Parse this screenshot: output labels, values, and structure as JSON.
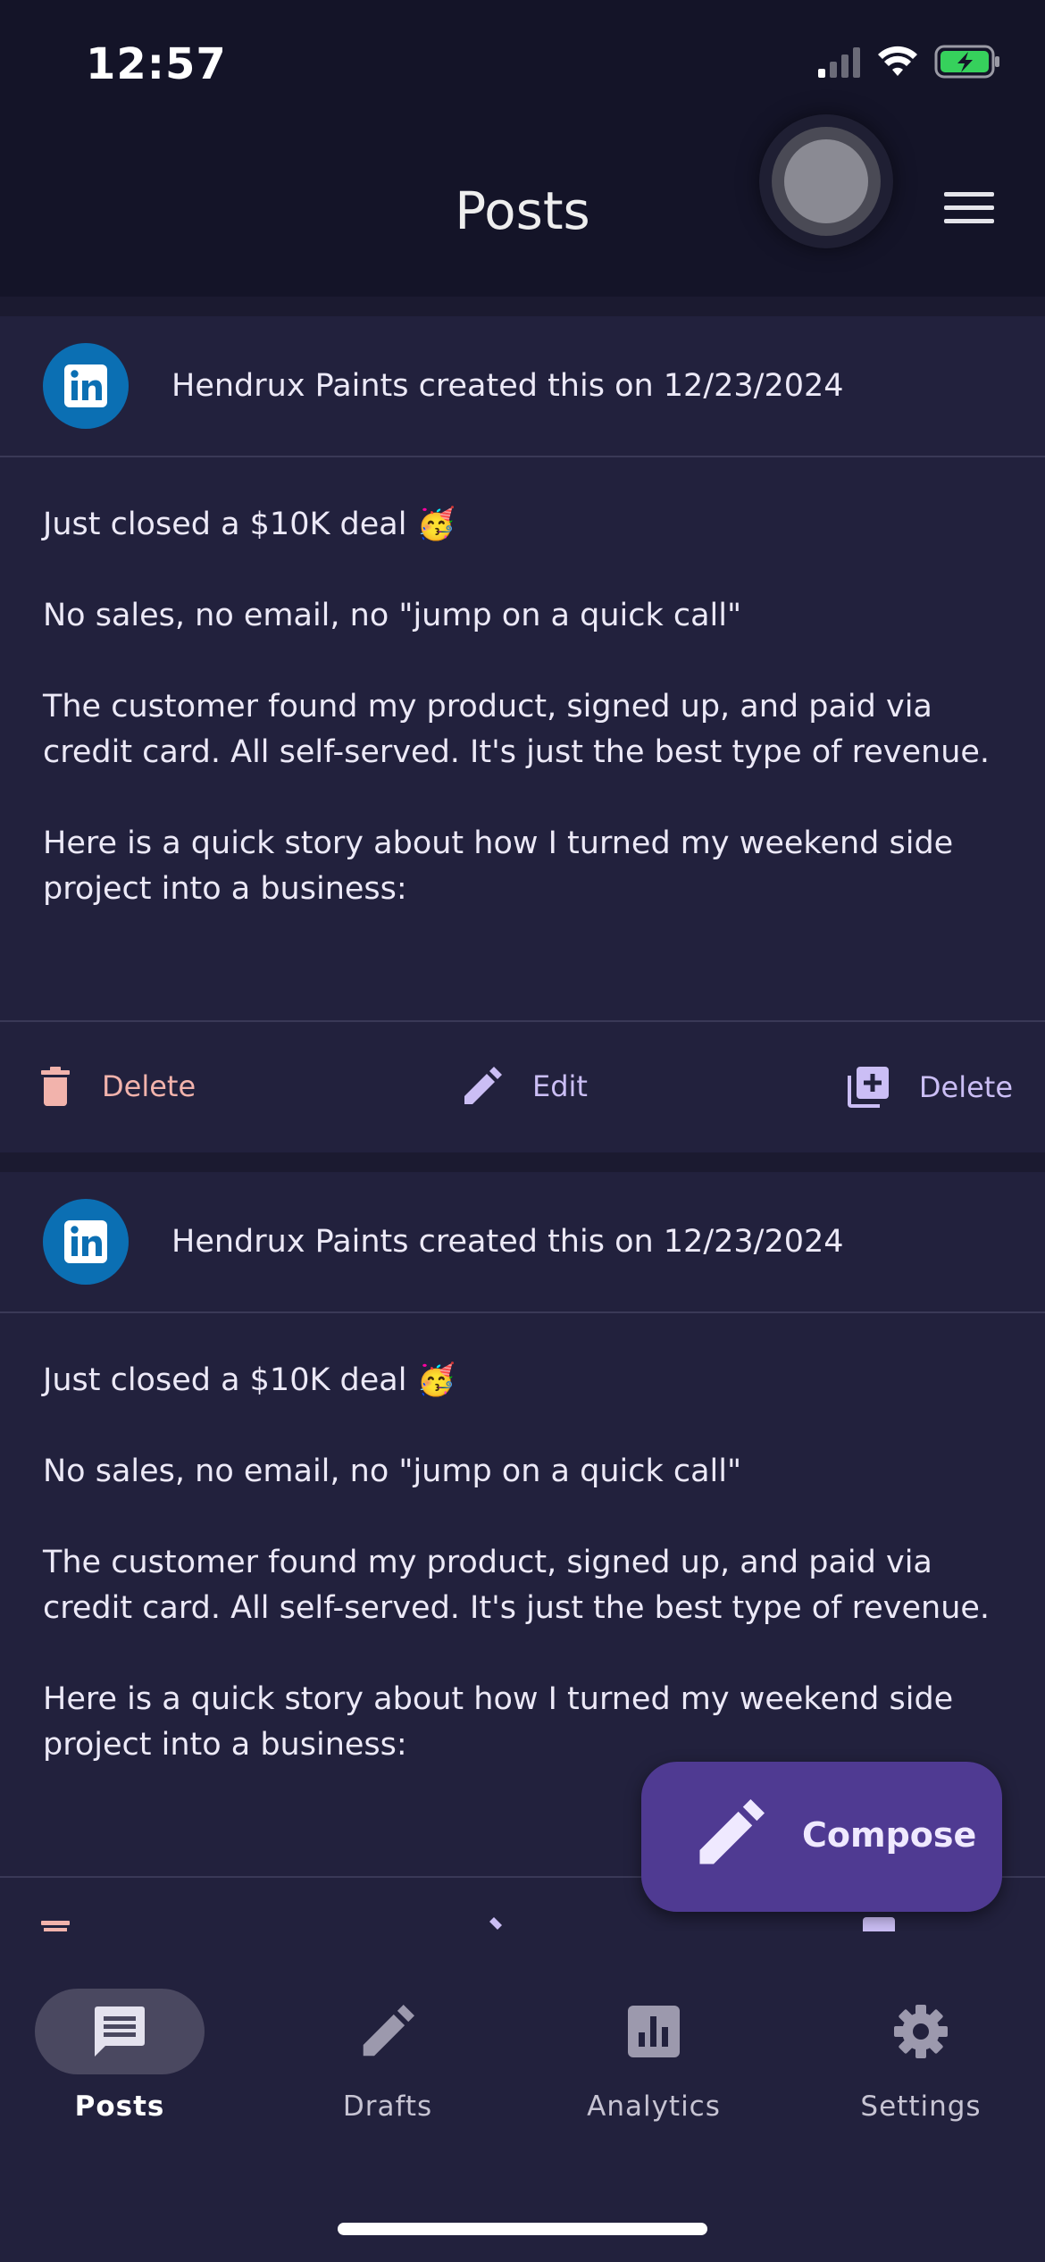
{
  "status_bar": {
    "time": "12:57",
    "icons": [
      "cellular-signal-icon",
      "wifi-icon",
      "battery-charging-icon"
    ]
  },
  "app_bar": {
    "title": "Posts",
    "menu_icon": "hamburger-menu-icon"
  },
  "posts": [
    {
      "platform_icon": "linkedin-icon",
      "author_line": "Hendrux Paints created this on 12/23/2024",
      "paragraphs": [
        "Just closed a $10K deal 🥳",
        "No sales, no email, no \"jump on a quick call\"",
        "The customer found my product, signed up, and paid via credit card. All self-served. It's just the best type of revenue.",
        "Here is a quick story about how I turned my weekend side project into a business:"
      ],
      "actions": {
        "delete_label": "Delete",
        "edit_label": "Edit",
        "copy_label": "Delete"
      }
    },
    {
      "platform_icon": "linkedin-icon",
      "author_line": "Hendrux Paints created this on 12/23/2024",
      "paragraphs": [
        "Just closed a $10K deal 🥳",
        "No sales, no email, no \"jump on a quick call\"",
        "The customer found my product, signed up, and paid via credit card. All self-served. It's just the best type of revenue.",
        "Here is a quick story about how I turned my weekend side project into a business:"
      ]
    }
  ],
  "fab": {
    "label": "Compose",
    "icon": "pencil-icon"
  },
  "bottom_nav": {
    "items": [
      {
        "label": "Posts",
        "icon": "chat-bubble-icon",
        "active": true
      },
      {
        "label": "Drafts",
        "icon": "pencil-icon",
        "active": false
      },
      {
        "label": "Analytics",
        "icon": "bar-chart-icon",
        "active": false
      },
      {
        "label": "Settings",
        "icon": "gear-icon",
        "active": false
      }
    ]
  },
  "colors": {
    "background": "#22213d",
    "app_bar": "#141428",
    "accent": "#4f3a92",
    "delete": "#f2b3ac",
    "action": "#cbbef5",
    "linkedin": "#0b6fb3"
  }
}
